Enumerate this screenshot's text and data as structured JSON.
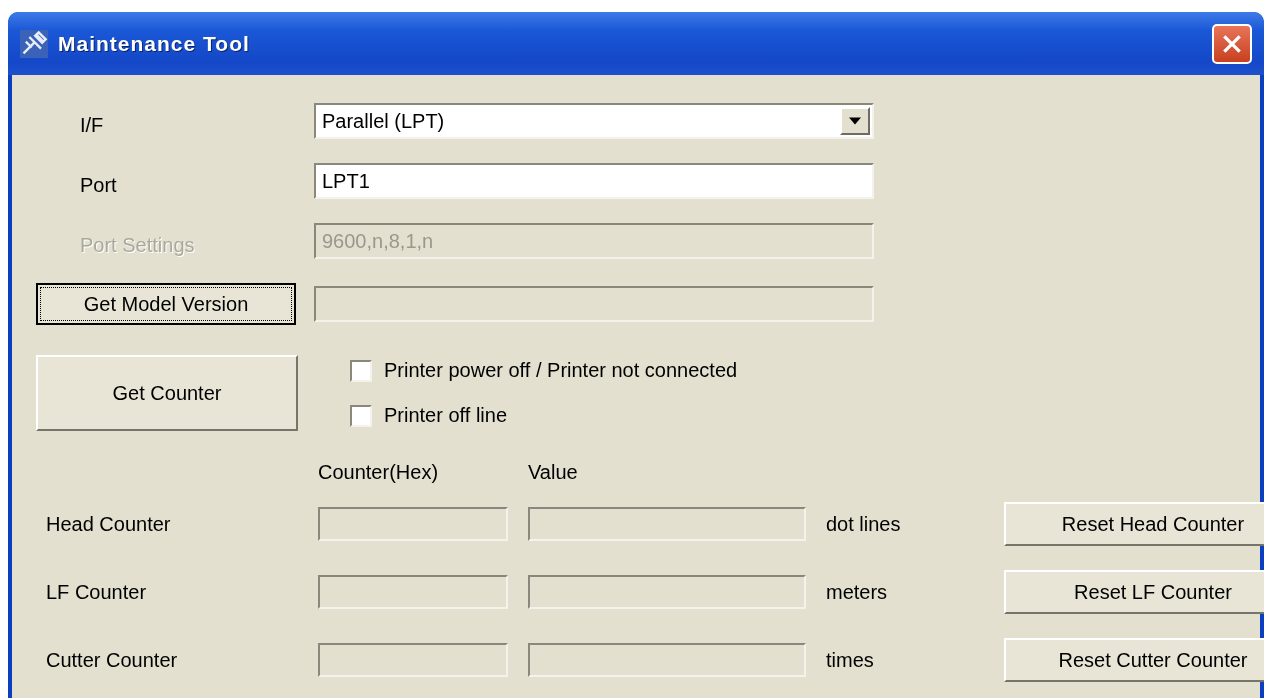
{
  "window": {
    "title": "Maintenance Tool"
  },
  "settings": [
    {
      "kind": "dropdown",
      "label": "I/F",
      "value": "Parallel (LPT)",
      "disabled": false
    },
    {
      "kind": "text",
      "label": "Port",
      "value": "LPT1",
      "disabled": false
    },
    {
      "kind": "text",
      "label": "Port Settings",
      "value": "9600,n,8,1,n",
      "disabled": true
    }
  ],
  "model_version": {
    "button": "Get Model Version",
    "focused": true
  },
  "get_counter": {
    "button": "Get Counter",
    "focused": false
  },
  "status_checkboxes": [
    {
      "label": "Printer power off / Printer not connected",
      "checked": false
    },
    {
      "label": "Printer off line",
      "checked": false
    }
  ],
  "counter_headers": [
    "Counter(Hex)",
    "Value"
  ],
  "counters": [
    {
      "label": "Head Counter",
      "unit": "dot lines",
      "reset_button": "Reset Head Counter"
    },
    {
      "label": "LF Counter",
      "unit": "meters",
      "reset_button": "Reset LF Counter"
    },
    {
      "label": "Cutter Counter",
      "unit": "times",
      "reset_button": "Reset Cutter Counter"
    }
  ]
}
